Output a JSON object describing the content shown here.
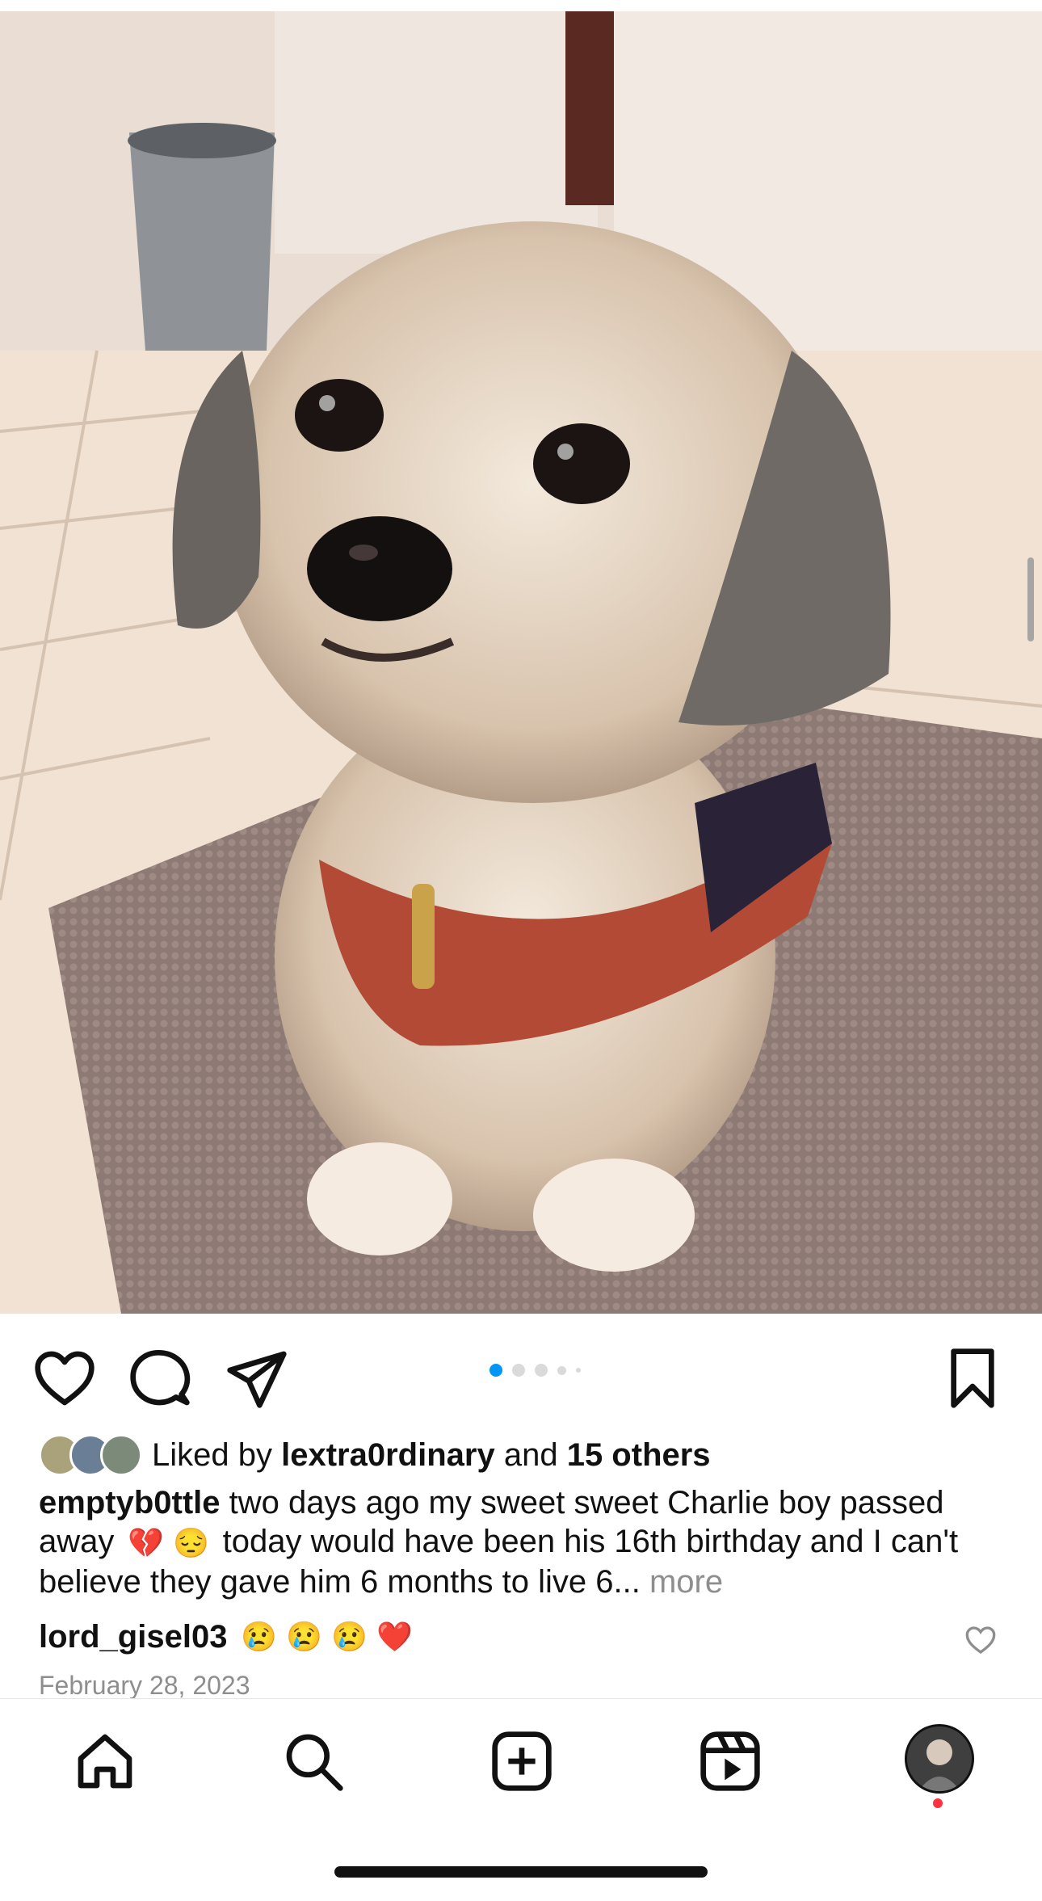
{
  "post": {
    "pagination": {
      "current": 1,
      "total": 5
    },
    "likes": {
      "prefix": "Liked by",
      "user": "lextra0rdinary",
      "connector": "and",
      "others": "15 others"
    },
    "caption": {
      "username": "emptyb0ttle",
      "text_part1": "two days ago my sweet sweet Charlie boy passed away",
      "emoji1": "💔",
      "emoji2": "😔",
      "text_part2": "today would have been his 16th birthday and I can't believe they gave him 6 months to live 6...",
      "more": "more"
    },
    "comment": {
      "username": "lord_gisel03",
      "emojis": [
        "😢",
        "😢",
        "😢",
        "❤️"
      ]
    },
    "date": "February 28, 2023"
  },
  "icons": {
    "like": "heart-icon",
    "comment": "comment-icon",
    "share": "send-icon",
    "save": "bookmark-icon"
  },
  "tabbar": [
    "home-icon",
    "search-icon",
    "create-icon",
    "reels-icon",
    "profile-avatar"
  ],
  "colors": {
    "accent": "#0095f6",
    "muted": "#8e8e8e",
    "notification": "#ff3040"
  }
}
